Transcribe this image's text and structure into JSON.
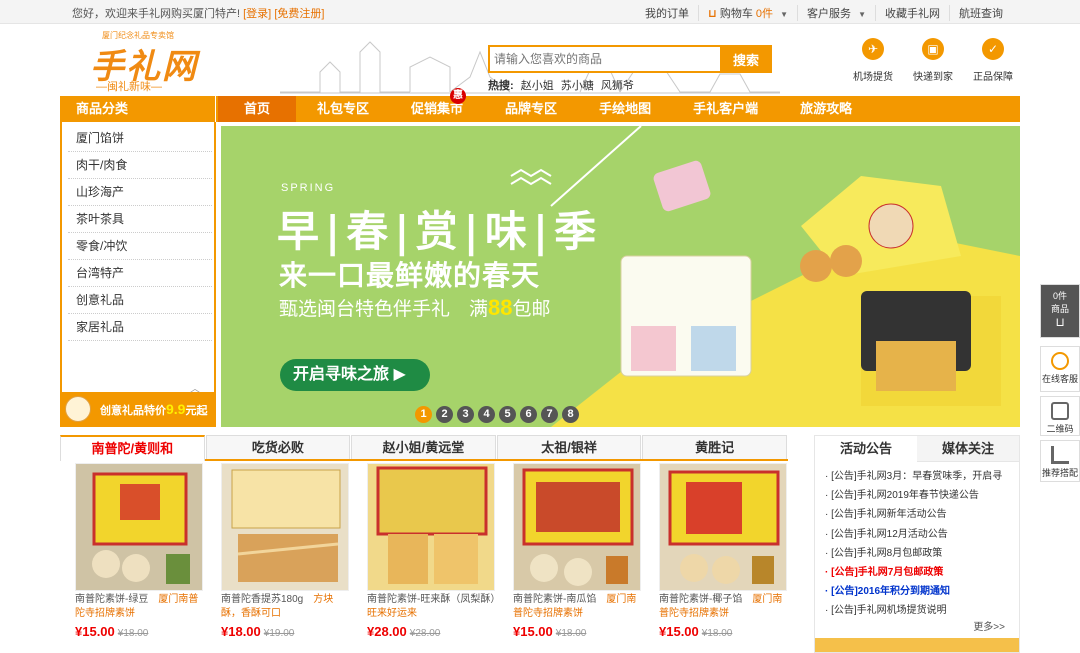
{
  "topbar": {
    "welcome": "您好，欢迎来手礼网购买厦门特产!",
    "login": "[登录]",
    "register": "[免费注册]",
    "links": {
      "my_orders": "我的订单",
      "cart_label": "购物车",
      "cart_count": "0件",
      "customer_service": "客户服务",
      "favorite": "收藏手礼网",
      "flight": "航班查询"
    }
  },
  "logo": {
    "tagline_top": "厦门纪念礼品专卖馆",
    "brand": "手礼网",
    "slogan": "—闽礼新味—"
  },
  "search": {
    "placeholder": "请输入您喜欢的商品",
    "button": "搜索",
    "hot_label": "热搜:",
    "hot_terms": [
      "赵小姐",
      "苏小糖",
      "风狮爷"
    ]
  },
  "services": [
    {
      "label": "机场提货",
      "icon": "plane-icon"
    },
    {
      "label": "快递到家",
      "icon": "truck-icon"
    },
    {
      "label": "正品保障",
      "icon": "badge-icon"
    }
  ],
  "nav": {
    "category_title": "商品分类",
    "items": [
      "首页",
      "礼包专区",
      "促销集市",
      "品牌专区",
      "手绘地图",
      "手礼客户端",
      "旅游攻略"
    ],
    "hui_badge": "惠"
  },
  "sidebar": {
    "categories": [
      "厦门馅饼",
      "肉干/肉食",
      "山珍海产",
      "茶叶茶具",
      "零食/冲饮",
      "台湾特产",
      "创意礼品",
      "家居礼品"
    ],
    "promo_text": "创意礼品特价",
    "promo_price": "9.9",
    "promo_suffix": "元起"
  },
  "banner": {
    "spring": "SPRING",
    "title": "早|春|赏|味|季",
    "subtitle": "来一口最鲜嫩的春天",
    "line2_prefix": "甄选闽台特色伴手礼　满",
    "line2_num": "88",
    "line2_suffix": "包邮",
    "cta": "开启寻味之旅",
    "dots": [
      "1",
      "2",
      "3",
      "4",
      "5",
      "6",
      "7",
      "8"
    ],
    "active_dot": 1,
    "colors": {
      "bg": "#a6d36a",
      "cta": "#1f8b44",
      "accent": "#f39800"
    }
  },
  "product_tabs": [
    "南普陀/黄则和",
    "吃货必败",
    "赵小姐/黄远堂",
    "太祖/银祥",
    "黄胜记"
  ],
  "products": [
    {
      "name": "南普陀素饼-绿豆",
      "promo": "厦门南普陀寺招牌素饼",
      "price": "¥15.00",
      "old_price": "¥18.00"
    },
    {
      "name": "南普陀香提苏180g",
      "promo": "方块酥，香酥可口",
      "price": "¥18.00",
      "old_price": "¥19.00"
    },
    {
      "name": "南普陀素饼-旺来酥（凤梨酥）",
      "promo": "旺来好运来",
      "price": "¥28.00",
      "old_price": "¥28.00"
    },
    {
      "name": "南普陀素饼-南瓜馅",
      "promo": "厦门南普陀寺招牌素饼",
      "price": "¥15.00",
      "old_price": "¥18.00"
    },
    {
      "name": "南普陀素饼-椰子馅",
      "promo": "厦门南普陀寺招牌素饼",
      "price": "¥15.00",
      "old_price": "¥18.00"
    }
  ],
  "notice": {
    "tabs": [
      "活动公告",
      "媒体关注"
    ],
    "items": [
      {
        "text": "· [公告]手礼网3月：早春赏味季，开启寻",
        "style": "normal"
      },
      {
        "text": "· [公告]手礼网2019年春节快递公告",
        "style": "normal"
      },
      {
        "text": "· [公告]手礼网新年活动公告",
        "style": "normal"
      },
      {
        "text": "· [公告]手礼网12月活动公告",
        "style": "normal"
      },
      {
        "text": "· [公告]手礼网8月包邮政策",
        "style": "normal"
      },
      {
        "text": "· [公告]手礼网7月包邮政策",
        "style": "red"
      },
      {
        "text": "· [公告]2016年积分到期通知",
        "style": "blue"
      },
      {
        "text": "· [公告]手礼网机场提货说明",
        "style": "normal"
      }
    ],
    "more": "更多>>"
  },
  "float_bar": {
    "cart_count": "0件",
    "cart_label": "商品",
    "online": "在线客服",
    "qr": "二维码",
    "recommend": "推荐搭配"
  }
}
